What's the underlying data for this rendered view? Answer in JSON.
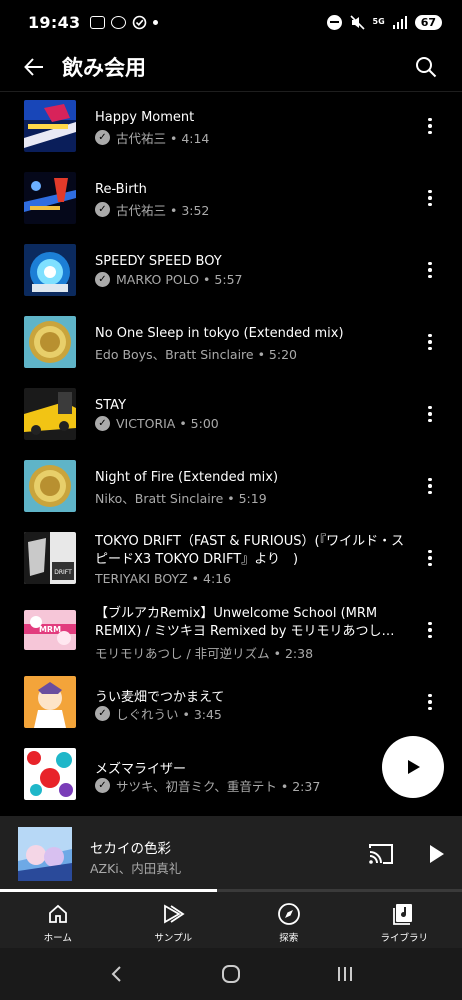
{
  "status_bar": {
    "time": "19:43",
    "network": "5G",
    "battery": "67"
  },
  "header": {
    "title": "飲み会用",
    "back_icon": "arrow-left-icon",
    "search_icon": "search-icon"
  },
  "songs": [
    {
      "title": "Happy Moment",
      "subtitle": "古代祐三 • 4:14",
      "verified": true
    },
    {
      "title": "Re-Birth",
      "subtitle": "古代祐三 • 3:52",
      "verified": true
    },
    {
      "title": "SPEEDY SPEED BOY",
      "subtitle": "MARKO POLO • 5:57",
      "verified": true
    },
    {
      "title": "No One Sleep in tokyo (Extended mix)",
      "subtitle": "Edo Boys、Bratt Sinclaire • 5:20",
      "verified": false
    },
    {
      "title": "STAY",
      "subtitle": "VICTORIA • 5:00",
      "verified": true
    },
    {
      "title": "Night of Fire (Extended mix)",
      "subtitle": "Niko、Bratt Sinclaire • 5:19",
      "verified": false
    },
    {
      "title": "TOKYO DRIFT（FAST & FURIOUS）(『ワイルド・スピードX3 TOKYO DRIFT』より　)",
      "subtitle": "TERIYAKI BOYZ • 4:16",
      "verified": false
    },
    {
      "title": "【ブルアカRemix】Unwelcome School (MRM REMIX) / ミツキヨ Remixed by モリモリあつし…",
      "subtitle": "モリモリあつし / 非可逆リズム • 2:38",
      "verified": false
    },
    {
      "title": "うい麦畑でつかまえて",
      "subtitle": "しぐれうい • 3:45",
      "verified": true
    },
    {
      "title": "メズマライザー",
      "subtitle": "サツキ、初音ミク、重音テト • 2:37",
      "verified": true
    }
  ],
  "now_playing": {
    "title": "セカイの色彩",
    "artist": "AZKi、内田真礼",
    "progress": 0.47
  },
  "bottom_nav": [
    {
      "label": "ホーム",
      "icon": "home-icon"
    },
    {
      "label": "サンプル",
      "icon": "samples-icon"
    },
    {
      "label": "探索",
      "icon": "compass-icon"
    },
    {
      "label": "ライブラリ",
      "icon": "library-icon"
    }
  ]
}
